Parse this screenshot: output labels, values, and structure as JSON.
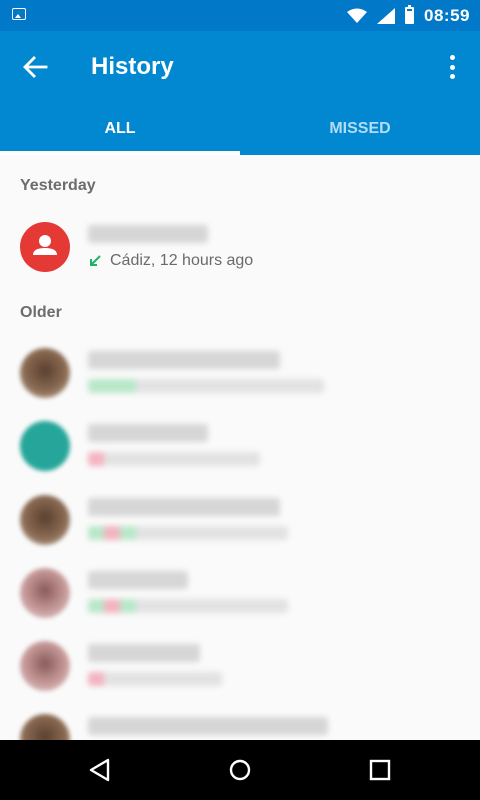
{
  "status_bar": {
    "time": "08:59",
    "battery_level": 0.85,
    "icons": [
      "image-icon",
      "wifi-icon",
      "signal-icon",
      "battery-icon"
    ]
  },
  "app_bar": {
    "title": "History",
    "back_icon": "arrow-back-icon",
    "menu_icon": "more-vert-icon",
    "color": "#0288d1"
  },
  "tabs": [
    {
      "label": "ALL",
      "active": true
    },
    {
      "label": "MISSED",
      "active": false
    }
  ],
  "sections": {
    "yesterday": "Yesterday",
    "older": "Older"
  },
  "calls": {
    "yesterday": [
      {
        "location_time": "Cádiz, 12 hours ago",
        "call_type": "incoming",
        "avatar_color": "#e53935"
      }
    ]
  },
  "nav_bar": {
    "icons": [
      "back-triangle-icon",
      "home-circle-icon",
      "recents-square-icon"
    ]
  }
}
